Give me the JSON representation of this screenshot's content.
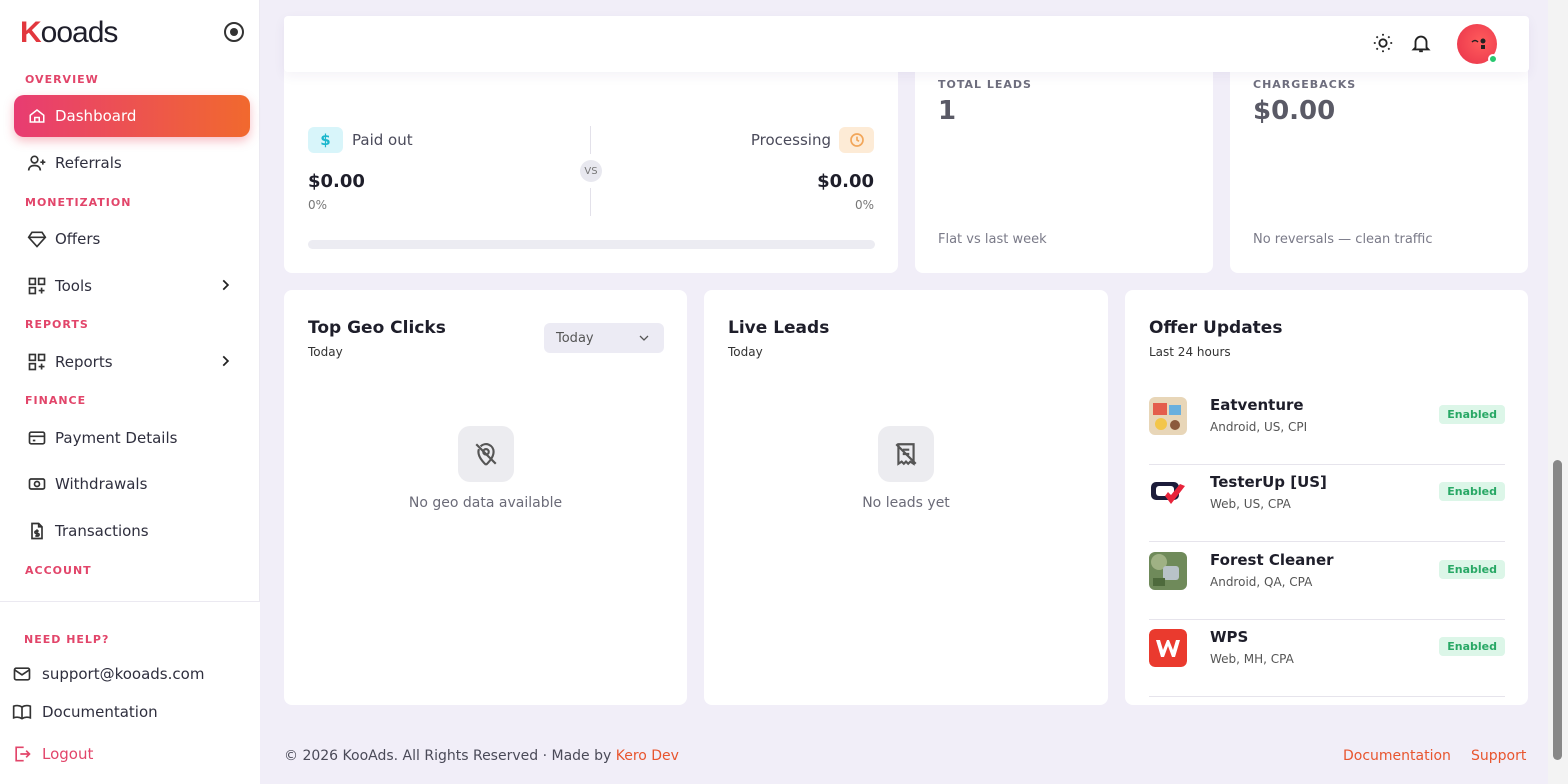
{
  "brand": {
    "logo_k": "K",
    "logo_rest": "ooads"
  },
  "sidebar": {
    "sections": {
      "overview": "OVERVIEW",
      "monetization": "MONETIZATION",
      "reports": "REPORTS",
      "finance": "FINANCE",
      "account": "ACCOUNT"
    },
    "items": {
      "dashboard": "Dashboard",
      "referrals": "Referrals",
      "offers": "Offers",
      "tools": "Tools",
      "reports": "Reports",
      "payment_details": "Payment Details",
      "withdrawals": "Withdrawals",
      "transactions": "Transactions"
    },
    "help": {
      "label": "NEED HELP?",
      "email": "support@kooads.com",
      "docs": "Documentation",
      "logout": "Logout"
    }
  },
  "payout_card": {
    "paid_out_label": "Paid out",
    "paid_out_icon": "$",
    "paid_out_amount": "$0.00",
    "paid_out_pct": "0%",
    "processing_label": "Processing",
    "processing_amount": "$0.00",
    "processing_pct": "0%",
    "vs": "VS",
    "progress_fraction": 0
  },
  "total_leads": {
    "label": "TOTAL LEADS",
    "value": "1",
    "note": "Flat vs last week"
  },
  "chargebacks": {
    "label": "CHARGEBACKS",
    "value": "$0.00",
    "note": "No reversals — clean traffic"
  },
  "geo": {
    "title": "Top Geo Clicks",
    "sub": "Today",
    "select": "Today",
    "empty": "No geo data available"
  },
  "live": {
    "title": "Live Leads",
    "sub": "Today",
    "empty": "No leads yet"
  },
  "offer_updates": {
    "title": "Offer Updates",
    "sub": "Last 24 hours",
    "items": [
      {
        "name": "Eatventure",
        "meta": "Android, US, CPI",
        "status": "Enabled"
      },
      {
        "name": "TesterUp [US]",
        "meta": "Web, US, CPA",
        "status": "Enabled"
      },
      {
        "name": "Forest Cleaner",
        "meta": "Android, QA, CPA",
        "status": "Enabled"
      },
      {
        "name": "WPS",
        "meta": "Web, MH, CPA",
        "status": "Enabled"
      }
    ]
  },
  "footer": {
    "copy": "© 2026 KooAds. All Rights Reserved · Made by ",
    "author": "Kero Dev",
    "docs": "Documentation",
    "support": "Support"
  },
  "colors": {
    "accent_start": "#e83c72",
    "accent_end": "#f1692e",
    "enabled": "#28a865",
    "paid_icon": "#2ecbe0",
    "processing_icon": "#f2a65a"
  }
}
